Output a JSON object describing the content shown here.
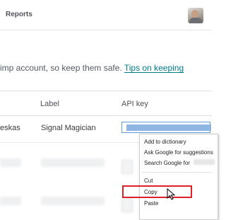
{
  "topbar": {
    "title": "Reports"
  },
  "info": {
    "text": "imp account, so keep them safe. ",
    "link": "Tips on keeping"
  },
  "table": {
    "headers": {
      "label": "Label",
      "api_key": "API key"
    },
    "rows": [
      {
        "name": "eskas",
        "label": "Signal Magician"
      }
    ]
  },
  "context_menu": {
    "items": [
      "Add to dictionary",
      "Ask Google for suggestions",
      "Search Google for",
      "Cut",
      "Copy",
      "Paste"
    ]
  },
  "colors": {
    "link": "#007c89",
    "highlight": "#e02027",
    "selection": "#8fb6e3"
  }
}
